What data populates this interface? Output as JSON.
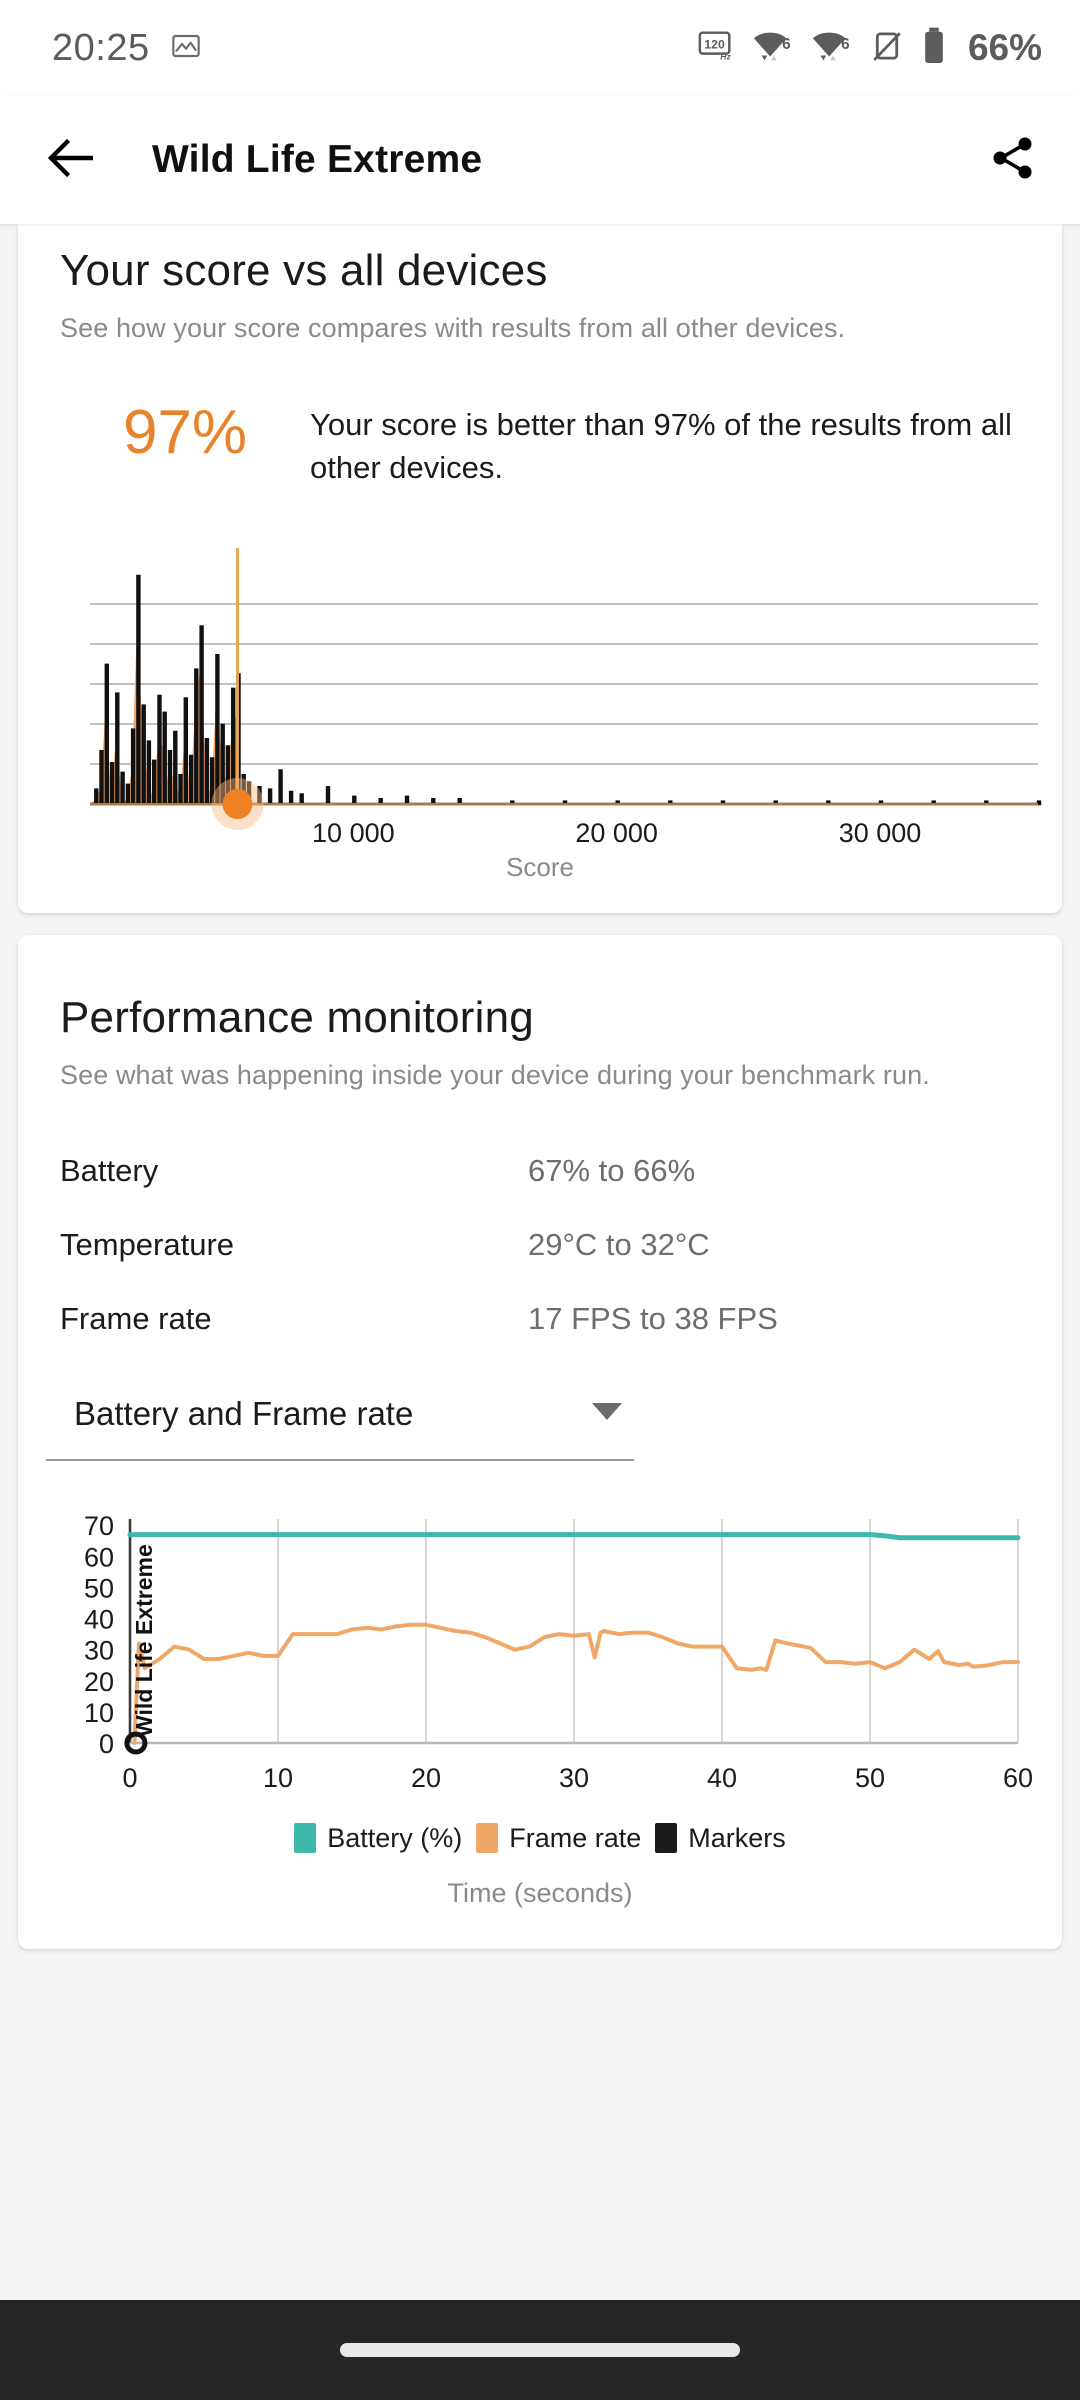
{
  "status_bar": {
    "time": "20:25",
    "battery_percent": "66%",
    "icons": [
      "image-icon",
      "refresh-rate-120hz-icon",
      "wifi-6-icon",
      "wifi-6-icon",
      "vibrate-off-icon",
      "battery-icon"
    ]
  },
  "app_bar": {
    "title": "Wild Life Extreme",
    "back_icon": "back-arrow-icon",
    "share_icon": "share-icon"
  },
  "score_card": {
    "title": "Your score vs all devices",
    "subtitle": "See how your score compares with results from all other devices.",
    "percentile_value": "97%",
    "percentile_text": "Your score is better than 97% of the results from all other devices.",
    "accent_color": "#e8822b"
  },
  "performance_card": {
    "title": "Performance monitoring",
    "subtitle": "See what was happening inside your device during your benchmark run.",
    "stats": [
      {
        "label": "Battery",
        "value": "67% to 66%"
      },
      {
        "label": "Temperature",
        "value": "29°C to 32°C"
      },
      {
        "label": "Frame rate",
        "value": "17 FPS to 38 FPS"
      }
    ],
    "dropdown": {
      "selected": "Battery and Frame rate",
      "icon": "chevron-down-icon"
    },
    "legend": [
      {
        "label": "Battery (%)",
        "color": "#3fb8ac"
      },
      {
        "label": "Frame rate",
        "color": "#f0a868"
      },
      {
        "label": "Markers",
        "color": "#1b1b1b"
      }
    ],
    "x_axis_caption": "Time (seconds)"
  },
  "chart_data": [
    {
      "type": "area",
      "name": "score-distribution-histogram",
      "title": "Your score vs all devices",
      "xlabel": "Score",
      "ylabel": "",
      "xlim": [
        0,
        36000
      ],
      "ylim": [
        0,
        100
      ],
      "xticks": [
        10000,
        20000,
        30000
      ],
      "xtick_labels": [
        "10 000",
        "20 000",
        "30 000"
      ],
      "grid": true,
      "gridline_count": 5,
      "line_color": "#111111",
      "fill_color": "#f6a365",
      "marker_color": "#ef8023",
      "marker_score": 5600,
      "marker_percentile": 97,
      "x": [
        200,
        400,
        600,
        800,
        1000,
        1200,
        1400,
        1600,
        1800,
        2000,
        2200,
        2400,
        2600,
        2800,
        3000,
        3200,
        3400,
        3600,
        3800,
        4000,
        4200,
        4400,
        4600,
        4800,
        5000,
        5200,
        5400,
        5600,
        5800,
        6000,
        6400,
        6800,
        7200,
        7600,
        8000,
        9000,
        10000,
        11000,
        12000,
        13000,
        14000,
        16000,
        18000,
        20000,
        22000,
        24000,
        26000,
        28000,
        30000,
        32000,
        34000,
        36000
      ],
      "y": [
        6,
        22,
        58,
        17,
        46,
        13,
        8,
        31,
        95,
        41,
        26,
        18,
        45,
        38,
        22,
        30,
        12,
        44,
        20,
        56,
        74,
        27,
        19,
        62,
        33,
        24,
        48,
        54,
        12,
        9,
        7,
        6,
        14,
        5,
        4,
        7,
        3,
        2,
        3,
        2,
        2,
        1,
        1,
        1,
        1,
        1,
        1,
        1,
        1,
        1,
        1,
        1
      ]
    },
    {
      "type": "line",
      "name": "performance-monitoring-chart",
      "title": "Battery and Frame rate",
      "xlabel": "Time (seconds)",
      "ylabel": "",
      "xlim": [
        0,
        60
      ],
      "ylim": [
        0,
        72
      ],
      "xticks": [
        0,
        10,
        20,
        30,
        40,
        50,
        60
      ],
      "yticks": [
        0,
        10,
        20,
        30,
        40,
        50,
        60,
        70
      ],
      "grid": true,
      "legend_position": "bottom",
      "marker_label": "Wild Life Extreme",
      "marker_x": 0.4,
      "series": [
        {
          "name": "Battery (%)",
          "color": "#3fb8ac",
          "x": [
            0,
            5,
            10,
            15,
            20,
            25,
            30,
            35,
            40,
            45,
            50,
            51,
            52,
            55,
            60
          ],
          "values": [
            67,
            67,
            67,
            67,
            67,
            67,
            67,
            67,
            67,
            67,
            67,
            66.6,
            66,
            66,
            66
          ]
        },
        {
          "name": "Frame rate",
          "color": "#f0a868",
          "x": [
            0.3,
            0.6,
            1,
            2,
            3,
            4,
            5,
            6,
            7,
            8,
            9,
            10,
            11,
            11.5,
            12,
            13,
            14,
            15,
            16,
            17,
            18,
            19,
            20,
            21,
            22,
            23,
            24,
            25,
            26,
            27,
            28,
            29,
            30,
            31,
            31.4,
            31.8,
            32,
            33,
            34,
            35,
            36,
            37,
            38,
            39,
            40,
            41,
            42,
            42.6,
            43,
            43.6,
            44,
            44.4,
            45,
            46,
            47,
            48,
            49,
            50,
            51,
            52,
            53,
            54,
            54.6,
            55,
            55.6,
            56,
            56.6,
            57,
            58,
            59,
            60
          ],
          "values": [
            0,
            32,
            24,
            27,
            31,
            30,
            27,
            27,
            28,
            29,
            28,
            28,
            35,
            35,
            35,
            35,
            35,
            36.5,
            37,
            36.5,
            37.5,
            38,
            38,
            37,
            36,
            35.5,
            34,
            32,
            30,
            31,
            34,
            35,
            34.5,
            35,
            27.5,
            35.5,
            36,
            35,
            35.5,
            35.5,
            34,
            32,
            31,
            31,
            31,
            24,
            23.5,
            24,
            23.5,
            33,
            32.5,
            32,
            31.5,
            30.5,
            26,
            26,
            25.5,
            26,
            24,
            26,
            30,
            27,
            29.5,
            26,
            25.5,
            25,
            25.5,
            24.5,
            25,
            26,
            26
          ]
        }
      ]
    }
  ]
}
